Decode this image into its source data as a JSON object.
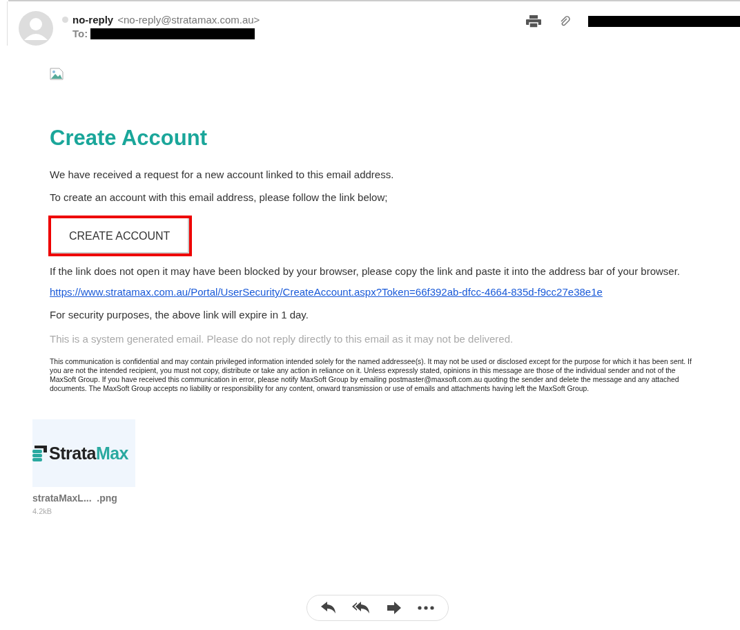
{
  "header": {
    "sender_name": "no-reply",
    "sender_address": "<no-reply@stratamax.com.au>",
    "to_label": "To:"
  },
  "body": {
    "title": "Create Account",
    "paragraphs": [
      "We have received a request for a new account linked to this email address.",
      "To create an account with this email address, please follow the link below;"
    ],
    "button": {
      "label": "CREATE ACCOUNT",
      "highlighted": true
    },
    "note": "If the link does not open it may have been blocked by your browser, please copy the link and paste it into the address bar of your browser.",
    "link": "https://www.stratamax.com.au/Portal/UserSecurity/CreateAccount.aspx?Token=66f392ab-dfcc-4664-835d-f9cc27e38e1e",
    "expiry": "For security purposes, the above link will expire in 1 day.",
    "system_note": "This is a system generated email. Please do not reply directly to this email as it may not be delivered.",
    "disclaimer": "This communication is confidential and may contain privileged information intended solely for the named addressee(s). It may not be used or disclosed except for the purpose for which it has been sent. If you are not the intended recipient, you must not copy, distribute or take any action in reliance on it. Unless expressly stated, opinions in this message are those of the individual sender and not of the MaxSoft Group. If you have received this communication in error, please notify MaxSoft Group by emailing postmaster@maxsoft.com.au quoting the sender and delete the message and any attached documents. The MaxSoft Group accepts no liability or responsibility for any content, onward transmission or use of emails and attachments having left the MaxSoft Group."
  },
  "attachment": {
    "logo_parts": [
      "Strata",
      "Max"
    ],
    "filename": "strataMaxL...  .png",
    "size": "4.2kB"
  }
}
